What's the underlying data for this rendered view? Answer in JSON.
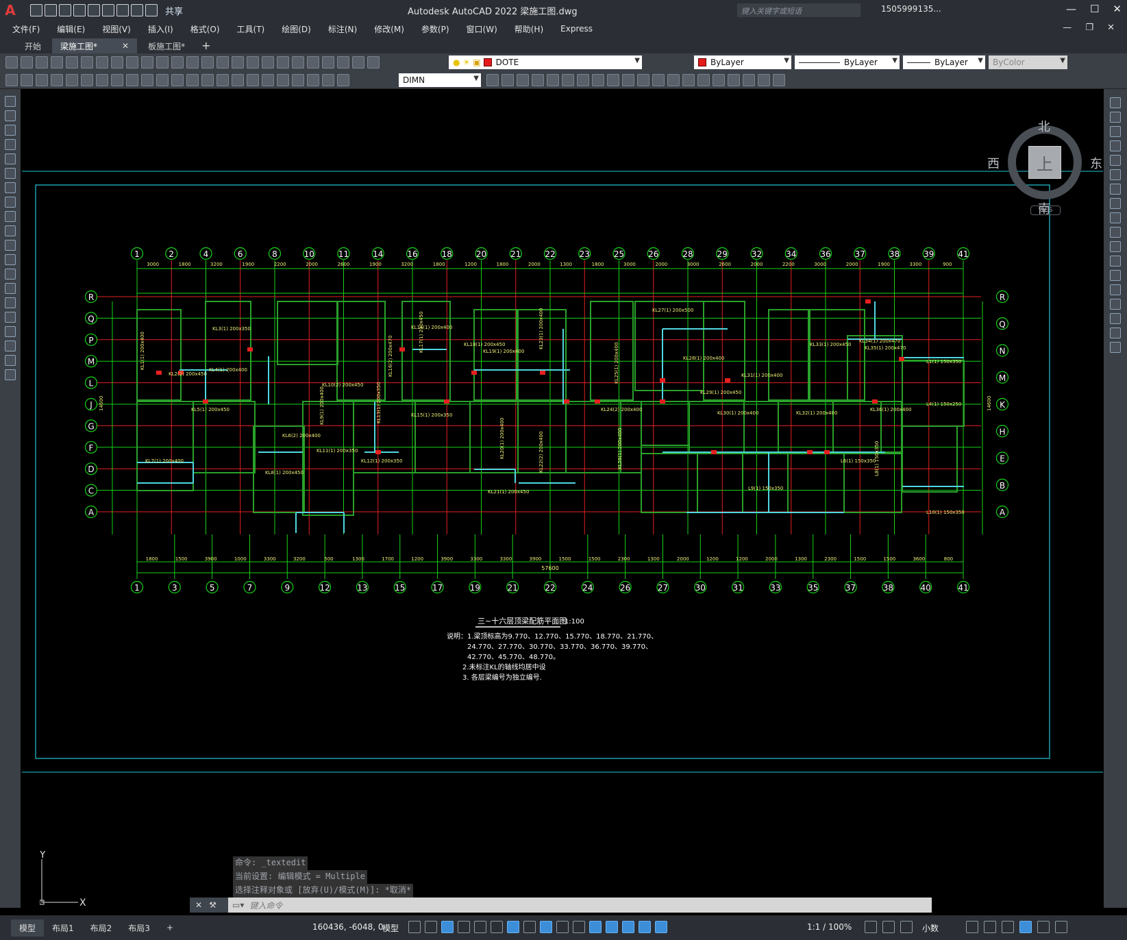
{
  "app": {
    "logo": "A",
    "share_label": "共享",
    "title": "Autodesk AutoCAD 2022    梁施工图.dwg",
    "search_placeholder": "键入关键字或短语",
    "user": "1505999135...",
    "window_buttons": [
      "—",
      "☐",
      "✕"
    ]
  },
  "menu": [
    "文件(F)",
    "编辑(E)",
    "视图(V)",
    "插入(I)",
    "格式(O)",
    "工具(T)",
    "绘图(D)",
    "标注(N)",
    "修改(M)",
    "参数(P)",
    "窗口(W)",
    "帮助(H)",
    "Express"
  ],
  "tabs": [
    {
      "label": "开始",
      "active": false
    },
    {
      "label": "梁施工图*",
      "active": true
    },
    {
      "label": "板施工图*",
      "active": false
    }
  ],
  "tab_plus": "+",
  "toolbar": {
    "layer": "DOTE",
    "color": "ByLayer",
    "linetype": "ByLayer",
    "lineweight": "ByLayer",
    "plotstyle": "ByColor",
    "dimstyle": "DIMN",
    "layer_color": "#e41b1b"
  },
  "viewcube": {
    "north": "北",
    "south": "南",
    "east": "东",
    "west": "西",
    "face": "上",
    "wcs": "WCS"
  },
  "drawing": {
    "top_axes": [
      "1",
      "2",
      "4",
      "6",
      "8",
      "10",
      "11",
      "14",
      "16",
      "18",
      "20",
      "21",
      "22",
      "23",
      "25",
      "26",
      "28",
      "29",
      "32",
      "34",
      "36",
      "37",
      "38",
      "39",
      "41"
    ],
    "top_dims": [
      "3000",
      "1800",
      "3200",
      "1900",
      "2200",
      "2000",
      "2600",
      "1900",
      "3200",
      "1800",
      "1200",
      "1800",
      "2000",
      "1300",
      "1800",
      "3000",
      "2000",
      "3000",
      "2600",
      "2000",
      "2200",
      "3000",
      "2000",
      "1900",
      "3300",
      "900"
    ],
    "bottom_axes": [
      "1",
      "3",
      "5",
      "7",
      "9",
      "12",
      "13",
      "15",
      "17",
      "19",
      "21",
      "22",
      "24",
      "26",
      "27",
      "30",
      "31",
      "33",
      "35",
      "37",
      "38",
      "40",
      "41"
    ],
    "bottom_dims": [
      "1800",
      "1500",
      "3900",
      "1000",
      "3300",
      "3200",
      "500",
      "1300",
      "1700",
      "1200",
      "3900",
      "3300",
      "3300",
      "3900",
      "1500",
      "1500",
      "2300",
      "1300",
      "2000",
      "1200",
      "1200",
      "2000",
      "1300",
      "2300",
      "1500",
      "1500",
      "3600",
      "800"
    ],
    "total_dim": "57600",
    "left_axes": [
      "R",
      "Q",
      "P",
      "M",
      "L",
      "J",
      "G",
      "F",
      "D",
      "C",
      "A"
    ],
    "right_axes": [
      "R",
      "Q",
      "N",
      "M",
      "K",
      "H",
      "E",
      "B",
      "A"
    ],
    "height_dim": "14600",
    "beam_labels": [
      "KL1(1) 200x400",
      "KL2(2) 200x450",
      "KL3(1) 200x350",
      "KL4(1) 200x400",
      "KL5(1) 200x450",
      "KL6(2) 200x400",
      "KL7(1) 200x400",
      "KL8(1) 200x450",
      "KL9(1) 200x400",
      "KL10(2) 200x450",
      "KL11(1) 200x350",
      "KL12(1) 200x350",
      "KL13(1) 200x350",
      "KL14(1) 200x400",
      "KL15(1) 200x350",
      "KL16(2) 200x470",
      "KL17(1) 200x450",
      "KL18(1) 200x450",
      "KL19(1) 200x400",
      "KL20(1) 200x400",
      "KL21(1) 200x450",
      "KL22(2) 200x400",
      "KL23(1) 200x400",
      "KL24(2) 200x400",
      "KL25(1) 200x400",
      "KL26(1) 200x400",
      "KL27(1) 200x500",
      "KL28(1) 200x400",
      "KL29(1) 200x450",
      "KL30(1) 200x400",
      "KL31(1) 200x400",
      "KL32(1) 200x400",
      "KL33(1) 200x450",
      "KL34(1) 200x470",
      "KL35(1) 200x470",
      "KL36(1) 200x400",
      "L1(1) 150x350",
      "L4(1) 150x250",
      "L6(1) 150x350",
      "L8(1) 150x350",
      "L9(1) 150x350",
      "L10(1) 150x350"
    ],
    "title": "三~十六层顶梁配筋平面图",
    "scale": "1:100",
    "notes": [
      "说明：1.梁顶标高为9.770、12.770、15.770、18.770、21.770、",
      "24.770、27.770、30.770、33.770、36.770、39.770、",
      "42.770、45.770、48.770。",
      "2.未标注KL的轴线均居中设",
      "3. 各层梁编号为独立编号."
    ]
  },
  "command": {
    "history": [
      "命令: _textedit",
      "当前设置: 编辑模式 = Multiple",
      "选择注释对象或 [放弃(U)/模式(M)]: *取消*"
    ],
    "placeholder": "键入命令"
  },
  "ucs": {
    "y": "Y",
    "x": "X"
  },
  "status": {
    "layout_tabs": [
      "模型",
      "布局1",
      "布局2",
      "布局3"
    ],
    "layout_plus": "+",
    "coords": "160436, -6048, 0",
    "model": "模型",
    "scale": "1:1 / 100%",
    "units": "小数"
  }
}
